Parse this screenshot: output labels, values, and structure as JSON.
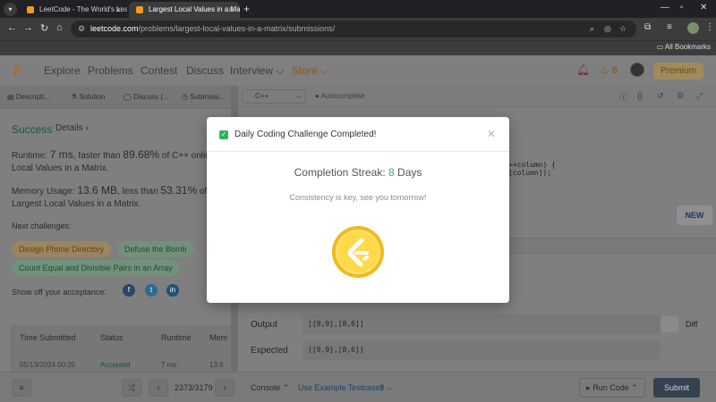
{
  "browser": {
    "tabs": [
      {
        "title": "LeetCode - The World's Leading"
      },
      {
        "title": "Largest Local Values in a Matrix"
      }
    ],
    "url_host": "leetcode.com",
    "url_path": "/problems/largest-local-values-in-a-matrix/submissions/",
    "bookmarks_label": "All Bookmarks"
  },
  "nav": {
    "items": [
      "Explore",
      "Problems",
      "Contest",
      "Discuss",
      "Interview",
      "Store"
    ],
    "streak_count": "8",
    "premium_label": "Premium"
  },
  "left": {
    "tabs": [
      "Descripti...",
      "Solution",
      "Discuss (...",
      "Submissi..."
    ],
    "status": "Success",
    "details_label": "Details",
    "runtime": {
      "label": "Runtime: ",
      "value": "7 ms",
      "mid": ", faster than ",
      "pct": "89.68%",
      "tail": " of C++ online"
    },
    "runtime_line2": "Local Values in a Matrix.",
    "memory": {
      "label": "Memory Usage: ",
      "value": "13.6 MB",
      "mid": ", less than ",
      "pct": "53.31%",
      "tail": " of C++"
    },
    "memory_line2": "Largest Local Values in a Matrix.",
    "next_label": "Next challenges:",
    "challenges": [
      "Design Phone Directory",
      "Defuse the Bomb",
      "Count Equal and Divisible Pairs in an Array"
    ],
    "share_label": "Show off your acceptance:",
    "table": {
      "headers": [
        "Time Submitted",
        "Status",
        "Runtime",
        "Mem"
      ],
      "row": [
        "05/13/2024 00:25",
        "Accepted",
        "7 ms",
        "13.6"
      ]
    }
  },
  "editor": {
    "language": "C++",
    "autocomplete_label": "Autocomplete",
    "code_lines": [
      "++column) {",
      "[column]);"
    ],
    "new_badge": "NEW",
    "output_label": "Output",
    "output_value": "[[9,9],[8,6]]",
    "expected_label": "Expected",
    "expected_value": "[[9,9],[8,6]]",
    "diff_label": "Diff"
  },
  "bottom": {
    "page_indicator": "2373/3179",
    "console_label": "Console",
    "example_label": "Use Example Testcases",
    "run_label": "Run Code",
    "submit_label": "Submit"
  },
  "modal": {
    "title": "Daily Coding Challenge Completed!",
    "streak_prefix": "Completion Streak: ",
    "streak_value": "8",
    "streak_suffix": " Days",
    "subtitle": "Consistency is key, see you tomorrow!"
  },
  "colors": {
    "accent_green": "#2db55d",
    "coin_yellow": "#f7c42b",
    "submit_dark": "#34414f"
  }
}
